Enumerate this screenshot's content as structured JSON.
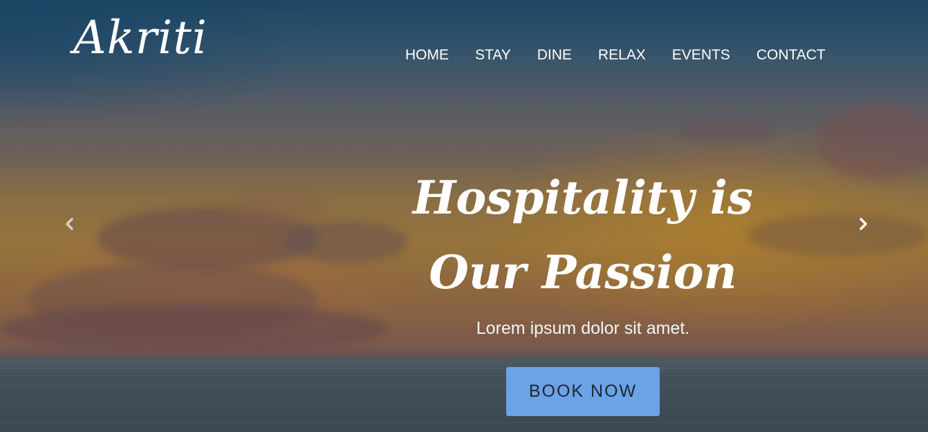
{
  "brand": {
    "logo_text": "Akriti"
  },
  "nav": {
    "items": [
      {
        "label": "HOME"
      },
      {
        "label": "STAY"
      },
      {
        "label": "DINE"
      },
      {
        "label": "RELAX"
      },
      {
        "label": "EVENTS"
      },
      {
        "label": "CONTACT"
      }
    ]
  },
  "hero": {
    "headline_line1": "Hospitality is",
    "headline_line2": "Our Passion",
    "subtitle": "Lorem ipsum dolor sit amet.",
    "cta_label": "BOOK NOW"
  },
  "carousel": {
    "prev_icon": "chevron-left-icon",
    "next_icon": "chevron-right-icon"
  },
  "colors": {
    "cta_background": "#6aa3e6",
    "cta_text": "#1f2630",
    "text": "#ffffff"
  }
}
